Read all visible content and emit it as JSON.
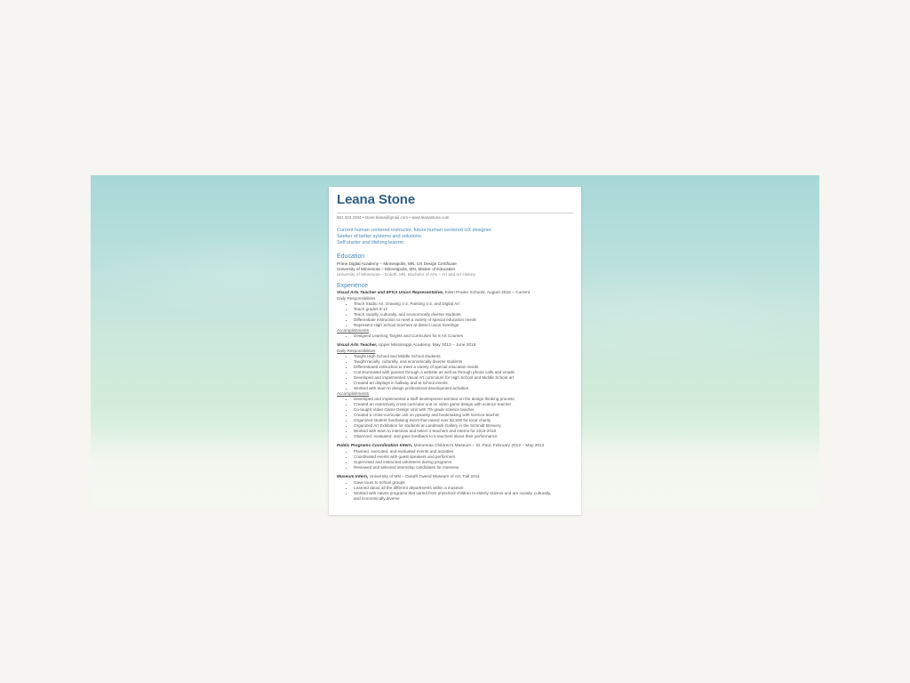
{
  "resume": {
    "name": "Leana Stone",
    "contact": "651.323.2334  •  stone.leana@gmail.com  •  www.leanastone.com",
    "summary": [
      "Current human centered instructor, future human centered UX designer.",
      "Seeker of better systems and solutions.",
      "Self-starter and lifelong learner."
    ],
    "education": {
      "heading": "Education",
      "lines": [
        "Prime Digital Academy – Minneapolis, MN, UX Design Certificate",
        "University of Minnesota – Minneapolis, MN, Master of Education",
        "University of Minnesota – Duluth, MN, Bachelor of Arts – Art and Art History"
      ]
    },
    "experience": {
      "heading": "Experience",
      "jobs": [
        {
          "role": "Visual Arts Teacher and EFKA Union Representative,",
          "org": " Eden Prairie Schools, August 2016 – Current",
          "groups": [
            {
              "label": "Daily Responsibilities",
              "items": [
                "Teach Studio Art, Drawing 1-2, Painting 1-2, and Digital Art",
                "Teach grades 9-12",
                "Teach racially, culturally, and economically diverse students",
                "Differentiate instruction to meet a variety of special education needs",
                "Represent High School teachers at district union meetings"
              ]
            },
            {
              "label": "Accomplishments",
              "items": [
                "Designed Learning Targets and Curriculum for 8 Art Courses"
              ]
            }
          ]
        },
        {
          "role": "Visual Arts Teacher,",
          "org": " Upper Mississippi Academy, May 2013 – June 2016",
          "groups": [
            {
              "label": "Daily Responsibilities",
              "items": [
                "Taught High School and Middle School students",
                "Taught racially, culturally, and economically diverse students",
                "Differentiated instruction to meet a variety of special education needs",
                "Communicated with parents through a website as well as through phone calls and emails",
                "Developed and implemented Visual Art curriculum for High School and Middle School art",
                "Created art displays in hallway and at school events",
                "Worked with team to design professional development activities"
              ]
            },
            {
              "label": "Accomplishments",
              "items": [
                "Developed and implemented a staff development seminar on the design thinking process",
                "Created an extensively cross-curricular unit on video game design with science teacher",
                "Co-taught Video Game Design Unit with 7th grade science teacher",
                "Created a cross-curricular unit on pysanky and bookmaking with science teacher",
                "Organized student fundraising event that raised over $2,500 for local charity",
                "Organized Art Exhibition for students at Landmark Gallery in the Schmidt Brewery",
                "Worked with team to interview and select 4 teachers and interns for 2015-2016",
                "Observed, evaluated, and gave feedback to 5 teachers about their performance"
              ]
            }
          ]
        },
        {
          "role": "Public Programs Coordination Intern,",
          "org": " Minnesota Children's Museum – St. Paul, February 2012 – May 2012",
          "groups": [
            {
              "label": "",
              "items": [
                "Planned, executed, and evaluated events and activities",
                "Coordinated events with guest speakers and performers",
                "Supervised and instructed volunteers during programs",
                "Reviewed and selected internship candidates for interview"
              ]
            }
          ]
        },
        {
          "role": "Museum Intern,",
          "org": " University of MN – Duluth Tweed Museum of Art, Fall 2011",
          "groups": [
            {
              "label": "",
              "items": [
                "Gave tours to school groups",
                "Learned about all the different departments within a museum",
                "Worked with Haves programs that varied from preschool children to elderly citizens and are racially, culturally,",
                "and economically diverse"
              ]
            }
          ]
        }
      ]
    }
  }
}
